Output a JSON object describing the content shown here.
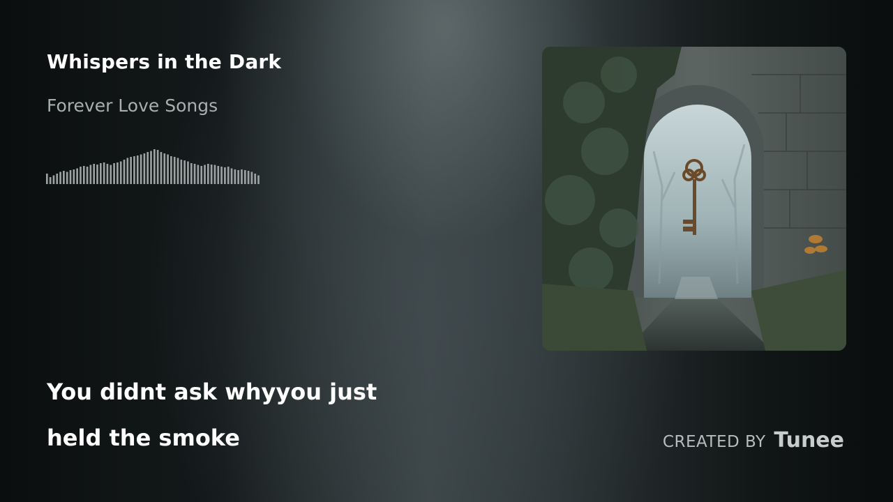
{
  "track": {
    "title": "Whispers in the Dark",
    "album": "Forever Love Songs"
  },
  "waveform": {
    "color": "#9da2a2",
    "levels": [
      0.3,
      0.2,
      0.25,
      0.3,
      0.35,
      0.38,
      0.35,
      0.4,
      0.42,
      0.45,
      0.5,
      0.52,
      0.5,
      0.55,
      0.58,
      0.56,
      0.6,
      0.62,
      0.58,
      0.55,
      0.6,
      0.62,
      0.65,
      0.7,
      0.75,
      0.78,
      0.8,
      0.82,
      0.85,
      0.88,
      0.92,
      0.95,
      1.0,
      0.98,
      0.92,
      0.88,
      0.85,
      0.8,
      0.78,
      0.75,
      0.7,
      0.68,
      0.65,
      0.6,
      0.58,
      0.55,
      0.52,
      0.55,
      0.58,
      0.56,
      0.55,
      0.52,
      0.5,
      0.48,
      0.5,
      0.45,
      0.42,
      0.4,
      0.42,
      0.4,
      0.38,
      0.35,
      0.3,
      0.25
    ]
  },
  "lyrics": {
    "line1": "You didnt ask whyyou just",
    "line2": "held the smoke"
  },
  "credit": {
    "prefix": "CREATED BY",
    "brand": "Tunee"
  },
  "cover_art": {
    "icon": "key-in-archway-icon"
  },
  "colors": {
    "text_primary": "#ffffff",
    "text_secondary": "#a9aeae",
    "background_dark": "#0b0e0e"
  }
}
